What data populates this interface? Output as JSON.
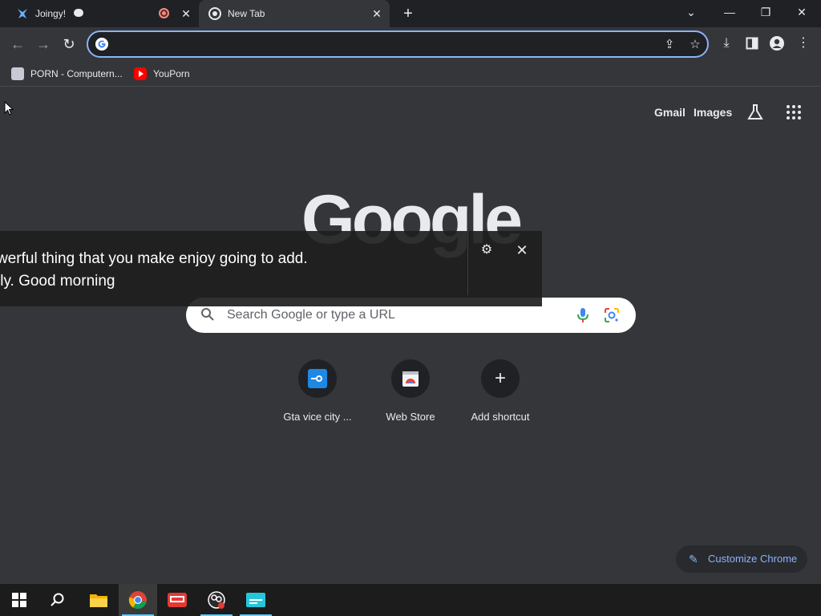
{
  "tabs": [
    {
      "title": "Joingy!",
      "active": false
    },
    {
      "title": "New Tab",
      "active": true
    }
  ],
  "omnibox": {
    "value": "",
    "placeholder": ""
  },
  "bookmarks": [
    {
      "label": "PORN - Computern..."
    },
    {
      "label": "YouPorn"
    }
  ],
  "header_links": {
    "gmail": "Gmail",
    "images": "Images"
  },
  "logo_text": "Google",
  "search": {
    "placeholder": "Search Google or type a URL"
  },
  "shortcuts": [
    {
      "label": "Gta vice city ..."
    },
    {
      "label": "Web Store"
    },
    {
      "label": "Add shortcut"
    }
  ],
  "customize_label": "Customize Chrome",
  "caption": {
    "line1": "werful thing that you make enjoy going to add.",
    "line2": "lly. Good morning"
  },
  "colors": {
    "accent": "#8ab4f8",
    "background": "#35363a",
    "tabstrip": "#202124"
  }
}
